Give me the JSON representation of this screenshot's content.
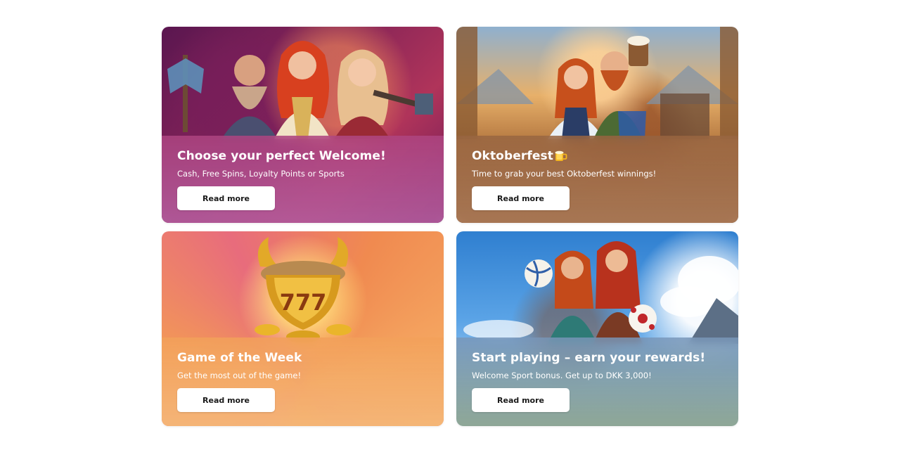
{
  "cards": [
    {
      "title": "Choose your perfect Welcome!",
      "subtitle": "Cash, Free Spins, Loyalty Points or Sports",
      "button_label": "Read more",
      "image": "three-viking-heroes-artwork"
    },
    {
      "title": "Oktoberfest",
      "title_icon": "beer-mug-icon",
      "subtitle": "Time to grab your best Oktoberfest winnings!",
      "button_label": "Read more",
      "image": "oktoberfest-couple-with-beer-artwork"
    },
    {
      "title": "Game of the Week",
      "subtitle": "Get the most out of the game!",
      "button_label": "Read more",
      "image": "golden-horned-777-trophy-artwork"
    },
    {
      "title": "Start playing – earn your rewards!",
      "subtitle": "Welcome Sport bonus. Get up to DKK 3,000!",
      "button_label": "Read more",
      "image": "two-sports-heroines-with-balls-artwork"
    }
  ],
  "colors": {
    "button_bg": "#ffffff",
    "button_text": "#1a1a1a",
    "card_text": "#ffffff",
    "mug_icon": "#f4b51e"
  }
}
